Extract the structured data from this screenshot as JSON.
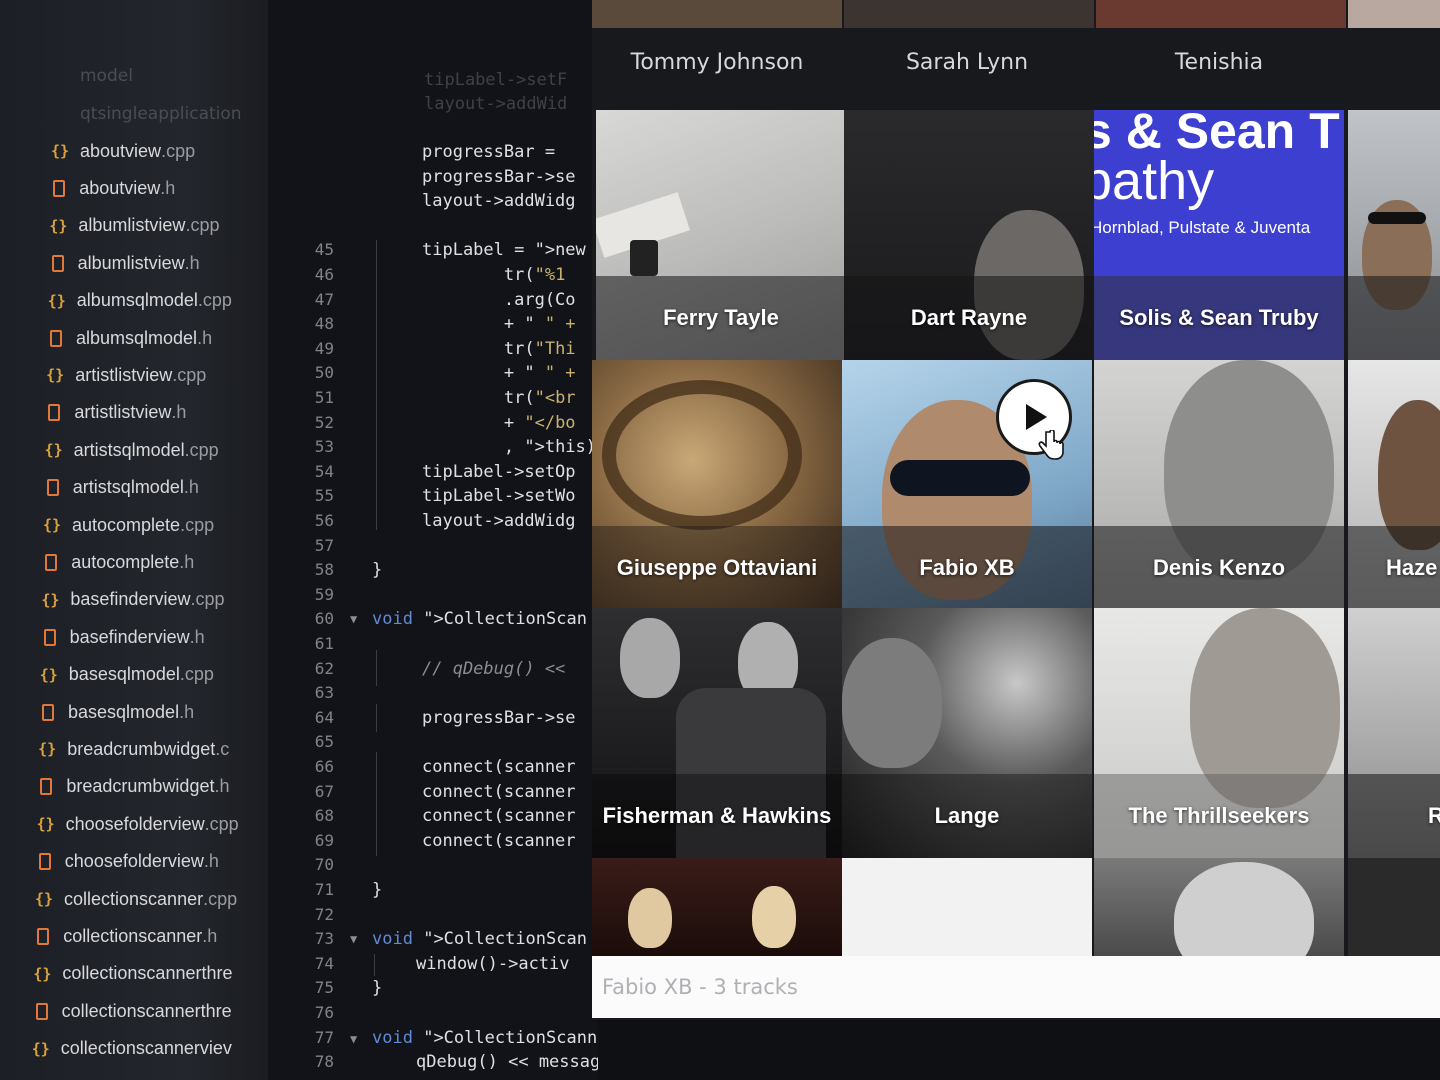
{
  "sidebar": {
    "faded_items": [
      "qtsingleapplication",
      "model"
    ],
    "files": [
      {
        "name": "aboutview",
        "ext": ".cpp",
        "type": "cpp"
      },
      {
        "name": "aboutview",
        "ext": ".h",
        "type": "h"
      },
      {
        "name": "albumlistview",
        "ext": ".cpp",
        "type": "cpp"
      },
      {
        "name": "albumlistview",
        "ext": ".h",
        "type": "h"
      },
      {
        "name": "albumsqlmodel",
        "ext": ".cpp",
        "type": "cpp"
      },
      {
        "name": "albumsqlmodel",
        "ext": ".h",
        "type": "h"
      },
      {
        "name": "artistlistview",
        "ext": ".cpp",
        "type": "cpp"
      },
      {
        "name": "artistlistview",
        "ext": ".h",
        "type": "h"
      },
      {
        "name": "artistsqlmodel",
        "ext": ".cpp",
        "type": "cpp"
      },
      {
        "name": "artistsqlmodel",
        "ext": ".h",
        "type": "h"
      },
      {
        "name": "autocomplete",
        "ext": ".cpp",
        "type": "cpp"
      },
      {
        "name": "autocomplete",
        "ext": ".h",
        "type": "h"
      },
      {
        "name": "basefinderview",
        "ext": ".cpp",
        "type": "cpp"
      },
      {
        "name": "basefinderview",
        "ext": ".h",
        "type": "h"
      },
      {
        "name": "basesqlmodel",
        "ext": ".cpp",
        "type": "cpp"
      },
      {
        "name": "basesqlmodel",
        "ext": ".h",
        "type": "h"
      },
      {
        "name": "breadcrumbwidget",
        "ext": ".c",
        "type": "cpp"
      },
      {
        "name": "breadcrumbwidget",
        "ext": ".h",
        "type": "h"
      },
      {
        "name": "choosefolderview",
        "ext": ".cpp",
        "type": "cpp"
      },
      {
        "name": "choosefolderview",
        "ext": ".h",
        "type": "h"
      },
      {
        "name": "collectionscanner",
        "ext": ".cpp",
        "type": "cpp"
      },
      {
        "name": "collectionscanner",
        "ext": ".h",
        "type": "h"
      },
      {
        "name": "collectionscannerthre",
        "ext": "",
        "type": "cpp"
      },
      {
        "name": "collectionscannerthre",
        "ext": "",
        "type": "h"
      },
      {
        "name": "collectionscannerviev",
        "ext": "",
        "type": "cpp"
      }
    ]
  },
  "editor": {
    "ghost_lines": [
      "tipLabel->setF",
      "layout->addWid"
    ],
    "lines": [
      {
        "n": "",
        "text": "progressBar ="
      },
      {
        "n": "",
        "text": "progressBar->se"
      },
      {
        "n": "",
        "text": "layout->addWidg"
      },
      {
        "n": "",
        "text": ""
      },
      {
        "n": "45",
        "text": "tipLabel = new"
      },
      {
        "n": "46",
        "text": "        tr(\"%1"
      },
      {
        "n": "47",
        "text": "        .arg(Co"
      },
      {
        "n": "48",
        "text": "        + \" \" +"
      },
      {
        "n": "49",
        "text": "        tr(\"Thi"
      },
      {
        "n": "50",
        "text": "        + \" \" +"
      },
      {
        "n": "51",
        "text": "        tr(\"<br"
      },
      {
        "n": "52",
        "text": "        + \"</bo"
      },
      {
        "n": "53",
        "text": "        , this)"
      },
      {
        "n": "54",
        "text": "tipLabel->setOp"
      },
      {
        "n": "55",
        "text": "tipLabel->setWo"
      },
      {
        "n": "56",
        "text": "layout->addWidg"
      },
      {
        "n": "57",
        "text": ""
      },
      {
        "n": "58",
        "text": "}"
      },
      {
        "n": "59",
        "text": ""
      },
      {
        "n": "60",
        "text": "void CollectionScan"
      },
      {
        "n": "61",
        "text": ""
      },
      {
        "n": "62",
        "text": "// qDebug() <<"
      },
      {
        "n": "63",
        "text": ""
      },
      {
        "n": "64",
        "text": "progressBar->se"
      },
      {
        "n": "65",
        "text": ""
      },
      {
        "n": "66",
        "text": "connect(scanner"
      },
      {
        "n": "67",
        "text": "connect(scanner"
      },
      {
        "n": "68",
        "text": "connect(scanner"
      },
      {
        "n": "69",
        "text": "connect(scanner"
      },
      {
        "n": "70",
        "text": ""
      },
      {
        "n": "71",
        "text": "}"
      },
      {
        "n": "72",
        "text": ""
      },
      {
        "n": "73",
        "text": "void CollectionScan"
      },
      {
        "n": "74",
        "text": "window()->activ"
      },
      {
        "n": "75",
        "text": "}"
      },
      {
        "n": "76",
        "text": ""
      },
      {
        "n": "77",
        "text": "void CollectionScannerView::scanError(QString message) {"
      },
      {
        "n": "78",
        "text": "qDebug() << message;"
      }
    ]
  },
  "grid": {
    "top_row": [
      "Tommy Johnson",
      "Sarah Lynn",
      "Tenishia"
    ],
    "tiles": [
      {
        "label": "Ferry Tayle"
      },
      {
        "label": "Dart Rayne"
      },
      {
        "label": "Solis & Sean Truby"
      },
      {
        "label": ""
      },
      {
        "label": "Giuseppe Ottaviani"
      },
      {
        "label": "Fabio XB"
      },
      {
        "label": "Denis Kenzo"
      },
      {
        "label": "Haze"
      },
      {
        "label": "Fisherman & Hawkins"
      },
      {
        "label": "Lange"
      },
      {
        "label": "The Thrillseekers"
      },
      {
        "label": "R"
      }
    ],
    "album_art_text": {
      "title_line1": "s & Sean T",
      "title_line2": "pathy",
      "credits": "Hornblad, Pulstate & Juventa"
    }
  },
  "status": {
    "text": "Fabio XB - 3 tracks"
  },
  "colors": {
    "keyword": "#5f8bd6",
    "function_name": "#b57cd8",
    "string": "#c8b36e",
    "cpp_icon": "#d9a23c",
    "header_icon": "#e0783a",
    "album_blue": "#3c3fd0"
  }
}
